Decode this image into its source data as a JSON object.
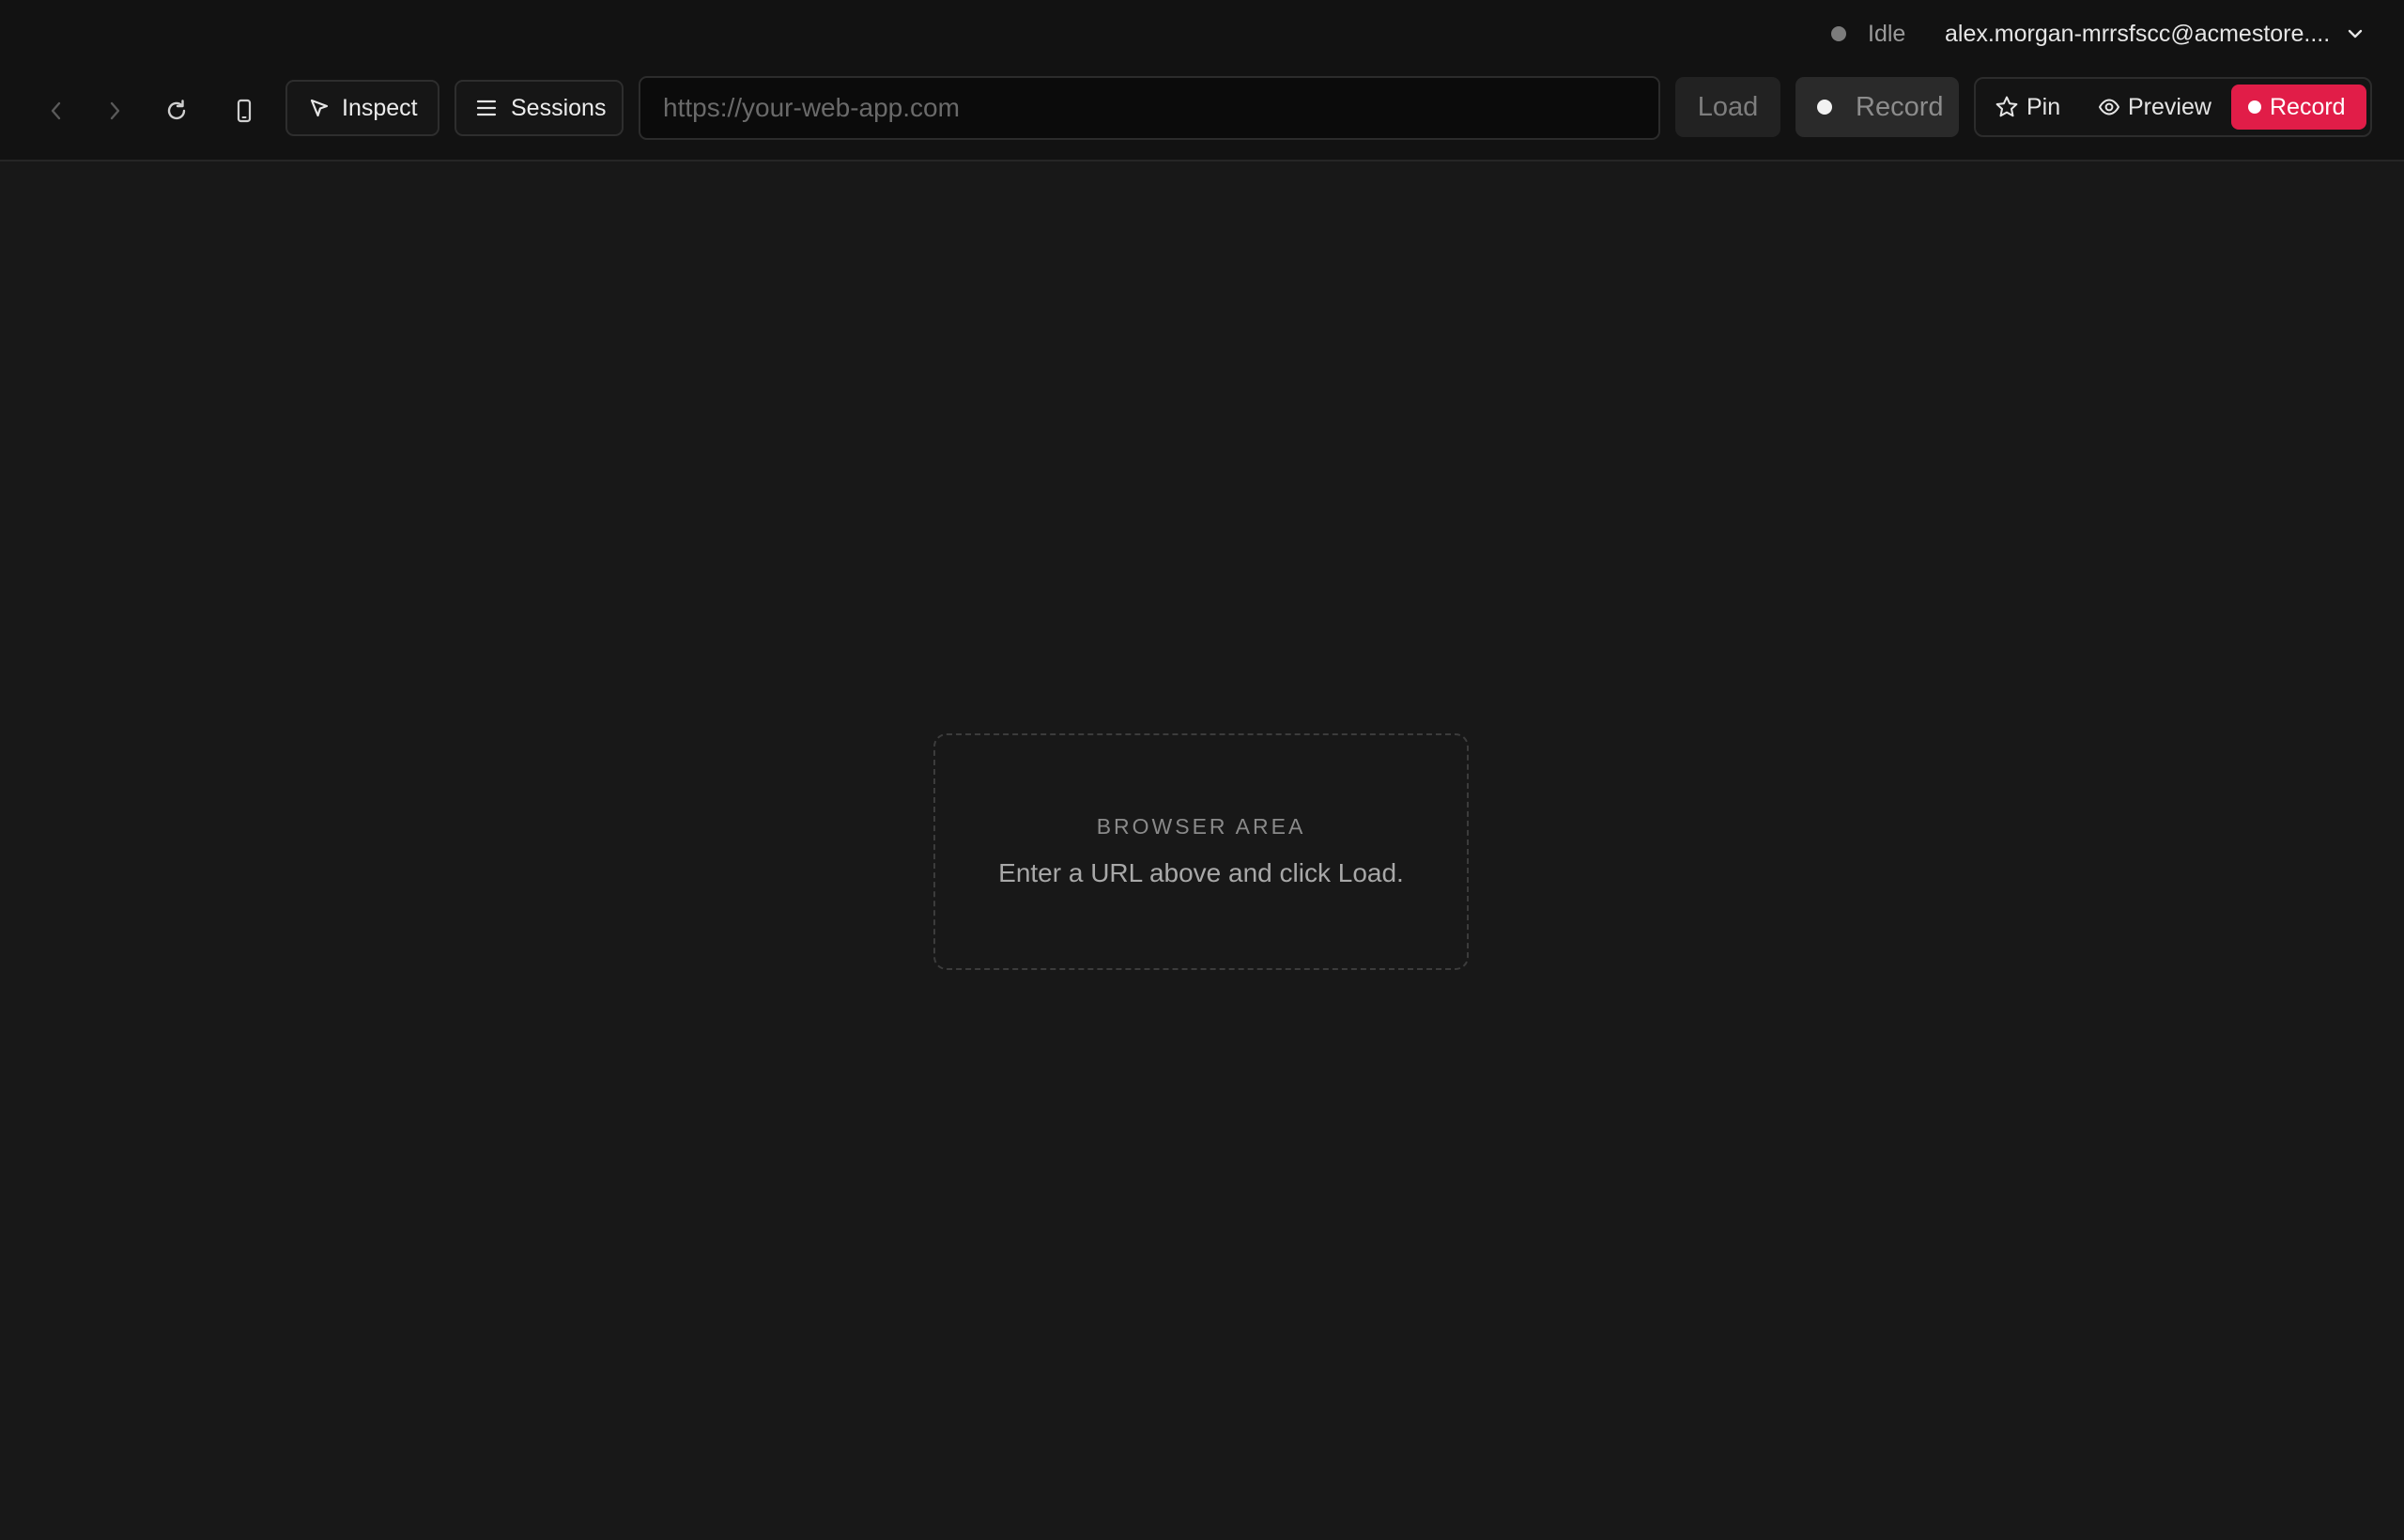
{
  "status": {
    "label": "Idle",
    "dot_color": "#7c7c7c"
  },
  "account": {
    "email": "alex.morgan-mrrsfscc@acmestore....",
    "icon": "chevron-down-icon"
  },
  "nav": {
    "back_icon": "chevron-left-icon",
    "forward_icon": "chevron-right-icon",
    "reload_icon": "refresh-icon",
    "device_icon": "mobile-device-icon"
  },
  "toolbar": {
    "inspect_label": "Inspect",
    "sessions_label": "Sessions",
    "url_value": "",
    "url_placeholder": "https://your-web-app.com",
    "load_label": "Load",
    "record_label": "Record"
  },
  "actions": {
    "pin_label": "Pin",
    "preview_label": "Preview",
    "record_label": "Record",
    "record_color": "#e11d48"
  },
  "browser": {
    "area_label": "BROWSER AREA",
    "hint": "Enter a URL above and click Load."
  }
}
